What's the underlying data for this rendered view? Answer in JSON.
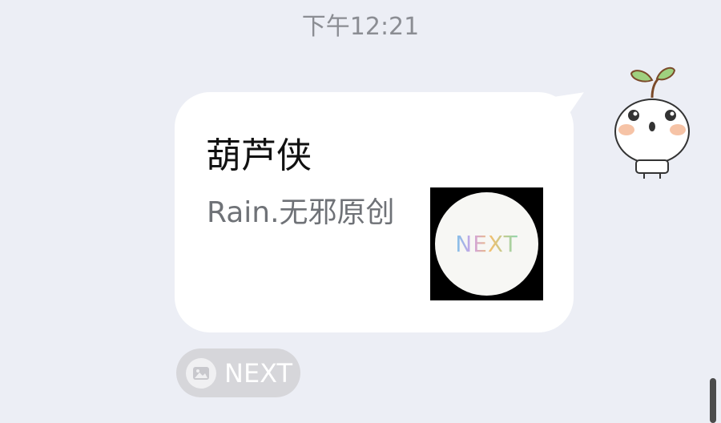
{
  "chat": {
    "timestamp": "下午12:21"
  },
  "message": {
    "title": "葫芦侠",
    "subtitle": "Rain.无邪原创",
    "thumbnail_text": "NEXT",
    "bubble_color": "#ffffff",
    "background_color": "#eceef5"
  },
  "app_chip": {
    "label": "NEXT",
    "icon": "image-icon"
  },
  "avatar": {
    "icon": "sprout-avatar-icon"
  }
}
